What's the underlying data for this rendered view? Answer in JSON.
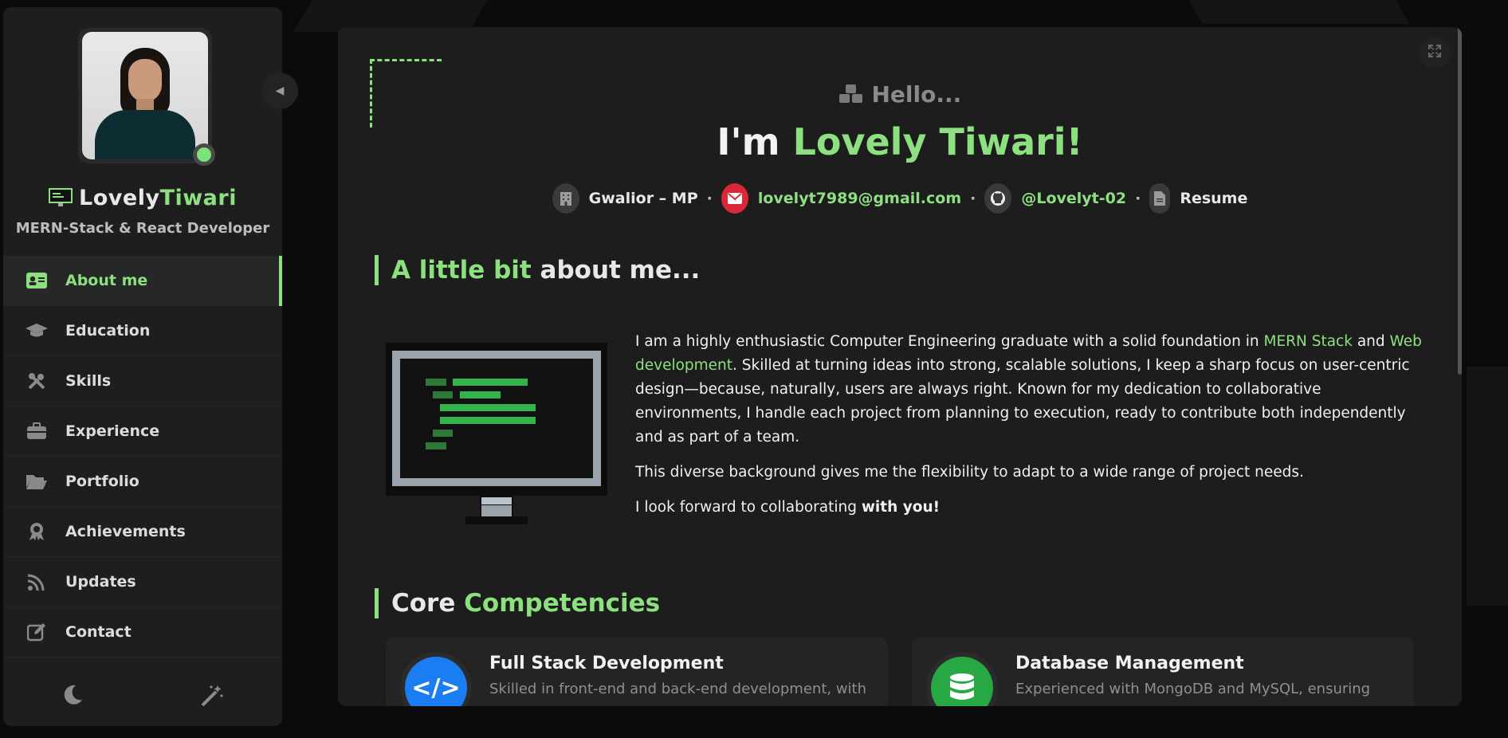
{
  "sidebar": {
    "name_first": "Lovely",
    "name_last": "Tiwari",
    "role": "MERN-Stack & React Developer",
    "items": [
      {
        "label": "About me",
        "icon": "id-card-icon",
        "active": true
      },
      {
        "label": "Education",
        "icon": "graduation-cap-icon"
      },
      {
        "label": "Skills",
        "icon": "tools-icon"
      },
      {
        "label": "Experience",
        "icon": "briefcase-icon"
      },
      {
        "label": "Portfolio",
        "icon": "folder-open-icon"
      },
      {
        "label": "Achievements",
        "icon": "award-icon"
      },
      {
        "label": "Updates",
        "icon": "rss-icon"
      },
      {
        "label": "Contact",
        "icon": "edit-icon"
      }
    ],
    "bottom_icons": [
      "moon-icon",
      "magic-wand-icon"
    ]
  },
  "main": {
    "hello": "Hello...",
    "headline_prefix": "I'm ",
    "headline_name": "Lovely Tiwari!",
    "contacts": {
      "location": "Gwalior – MP",
      "email": "lovelyt7989@gmail.com",
      "github": "@Lovelyt-02",
      "resume": "Resume"
    },
    "about_title_green": "A little bit",
    "about_title_white": " about me...",
    "about": {
      "p1_a": "I am a highly enthusiastic Computer Engineering graduate with a solid foundation in ",
      "p1_link1": "MERN Stack",
      "p1_and": " and ",
      "p1_link2": "Web development",
      "p1_b": ". Skilled at turning ideas into strong, scalable solutions, I keep a sharp focus on user-centric design—because, naturally, users are always right. Known for my dedication to collaborative environments, I handle each project from planning to execution, ready to contribute both independently and as part of a team.",
      "p2": "This diverse background gives me the flexibility to adapt to a wide range of project needs.",
      "p3_a": "I look forward to collaborating ",
      "p3_b": "with you!"
    },
    "core_title_white": "Core ",
    "core_title_green": "Competencies",
    "cards": [
      {
        "title": "Full Stack Development",
        "desc": "Skilled in front-end and back-end development, with",
        "icon": "code-icon",
        "color": "#1a7ef2"
      },
      {
        "title": "Database Management",
        "desc": "Experienced with MongoDB and MySQL, ensuring",
        "icon": "database-icon",
        "color": "#27a844"
      }
    ]
  },
  "colors": {
    "accent": "#8de07f",
    "panel": "#1d1d1d",
    "email_badge": "#d8283a"
  }
}
